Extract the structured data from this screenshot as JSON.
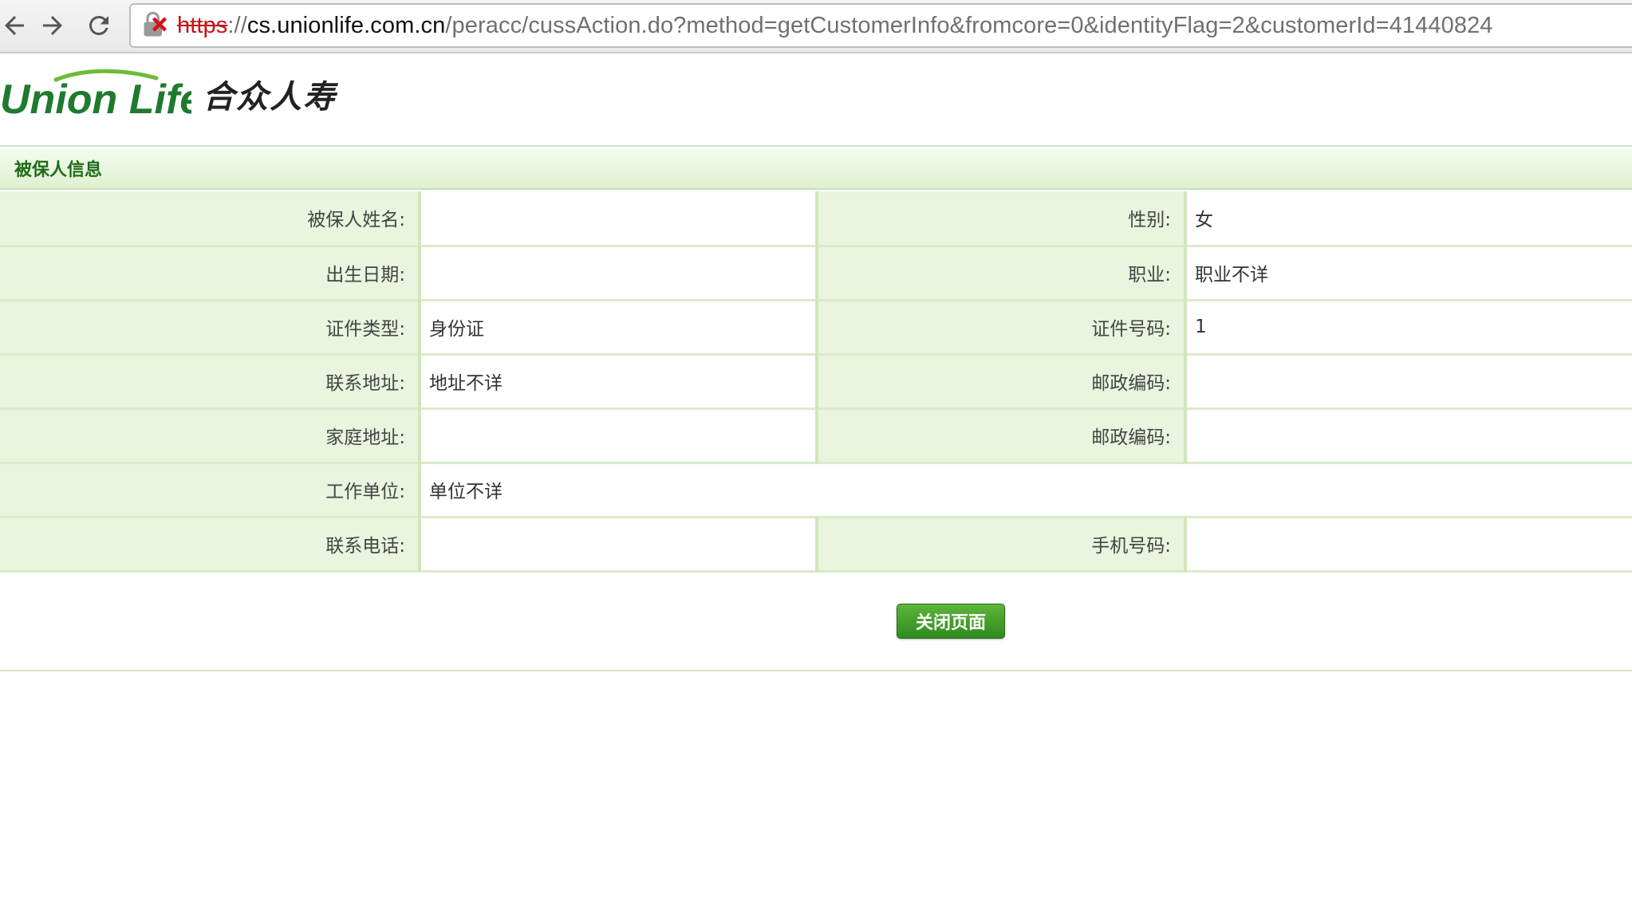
{
  "browser": {
    "url_scheme": "https",
    "url_sep": "://",
    "url_host": "cs.unionlife.com.cn",
    "url_path": "/peracc/cussAction.do?method=getCustomerInfo&fromcore=0&identityFlag=2&customerId=41440824"
  },
  "header": {
    "logo_en": "Union Life",
    "logo_cn": "合众人寿"
  },
  "section": {
    "title": "被保人信息"
  },
  "fields": {
    "name": {
      "label": "被保人姓名:",
      "value": ""
    },
    "gender": {
      "label": "性别:",
      "value": "女"
    },
    "birth_date": {
      "label": "出生日期:",
      "value": ""
    },
    "occupation": {
      "label": "职业:",
      "value": "职业不详"
    },
    "id_type": {
      "label": "证件类型:",
      "value": "身份证"
    },
    "id_number": {
      "label": "证件号码:",
      "value": "1"
    },
    "contact_address": {
      "label": "联系地址:",
      "value": "地址不详"
    },
    "postal_code_1": {
      "label": "邮政编码:",
      "value": ""
    },
    "home_address": {
      "label": "家庭地址:",
      "value": ""
    },
    "postal_code_2": {
      "label": "邮政编码:",
      "value": ""
    },
    "employer": {
      "label": "工作单位:",
      "value": "单位不详"
    },
    "phone": {
      "label": "联系电话:",
      "value": ""
    },
    "mobile": {
      "label": "手机号码:",
      "value": ""
    }
  },
  "actions": {
    "close_label": "关闭页面"
  },
  "colors": {
    "brand_green": "#1f7a2e",
    "label_bg": "#eaf4de",
    "button_green": "#3f9c2a"
  }
}
